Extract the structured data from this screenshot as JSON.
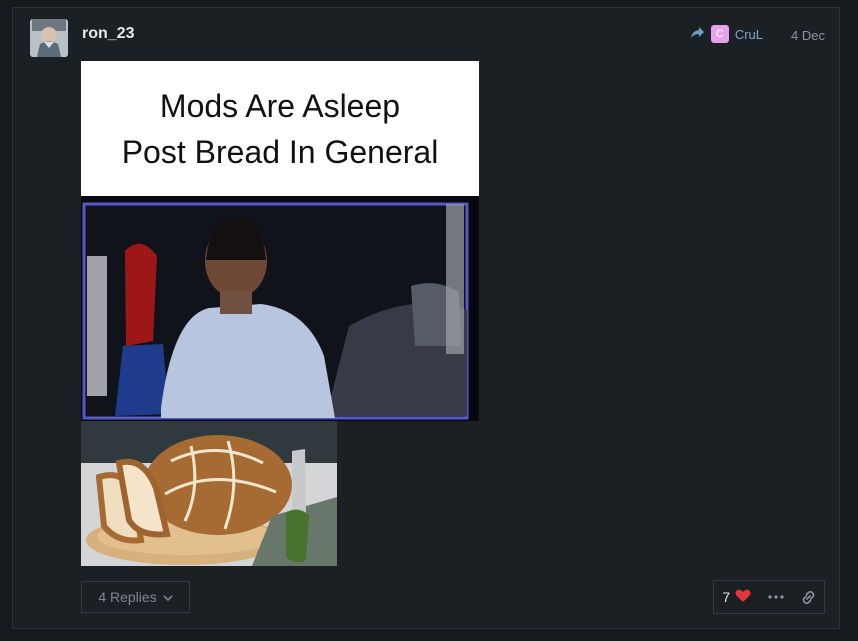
{
  "post": {
    "username": "ron_23",
    "reply_to_initial": "C",
    "reply_to_name": "CruL",
    "date": "4 Dec",
    "meme_line_1": "Mods Are Asleep",
    "meme_line_2": "Post Bread In General",
    "replies_label": "4 Replies",
    "like_count": "7"
  },
  "colors": {
    "background": "#151a1d",
    "post": "#1b2024",
    "link": "#7ea6c9",
    "heart": "#e0363b"
  },
  "icons": {
    "reply_arrow": "share-arrow-icon",
    "chevron": "chevron-down-icon",
    "heart": "heart-icon",
    "more": "ellipsis-icon",
    "link": "link-icon"
  }
}
